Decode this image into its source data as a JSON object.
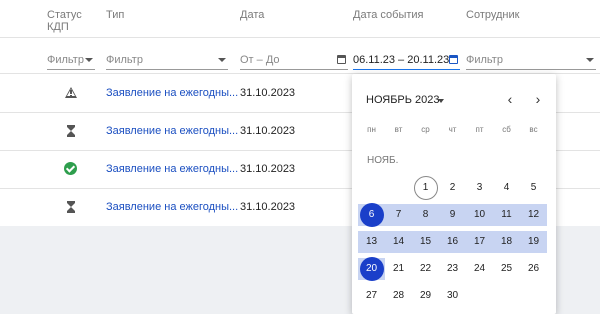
{
  "headers": {
    "status": "Статус КДП",
    "type": "Тип",
    "date": "Дата",
    "event_date": "Дата события",
    "employee": "Сотрудник"
  },
  "filters": {
    "status": "Фильтр",
    "type": "Фильтр",
    "date": "От – До",
    "event_date": "06.11.23 – 20.11.23",
    "employee": "Фильтр"
  },
  "rows": [
    {
      "status_icon": "warning-icon",
      "type": "Заявление на ежегодны...",
      "date": "31.10.2023"
    },
    {
      "status_icon": "hourglass-icon",
      "type": "Заявление на ежегодны...",
      "date": "31.10.2023"
    },
    {
      "status_icon": "check-circle-icon",
      "type": "Заявление на ежегодны...",
      "date": "31.10.2023"
    },
    {
      "status_icon": "hourglass-icon",
      "type": "Заявление на ежегодны...",
      "date": "31.10.2023"
    }
  ],
  "calendar": {
    "month_title": "НОЯБРЬ 2023",
    "month_label": "НОЯБ.",
    "weekdays": [
      "пн",
      "вт",
      "ср",
      "чт",
      "пт",
      "сб",
      "вс"
    ],
    "prev": "‹",
    "next": "›",
    "weeks": [
      [
        "",
        "",
        "",
        "1",
        "2",
        "3",
        "4",
        "5"
      ],
      [
        "6",
        "7",
        "8",
        "9",
        "10",
        "11",
        "12"
      ],
      [
        "13",
        "14",
        "15",
        "16",
        "17",
        "18",
        "19"
      ],
      [
        "20",
        "21",
        "22",
        "23",
        "24",
        "25",
        "26"
      ],
      [
        "27",
        "28",
        "29",
        "30"
      ]
    ],
    "range_start": "6",
    "range_end": "20",
    "today": "1",
    "colors": {
      "selected": "#1a3fc9",
      "range": "#c8d4f2",
      "link": "#1b4fc1",
      "success": "#2e9e4d"
    }
  }
}
